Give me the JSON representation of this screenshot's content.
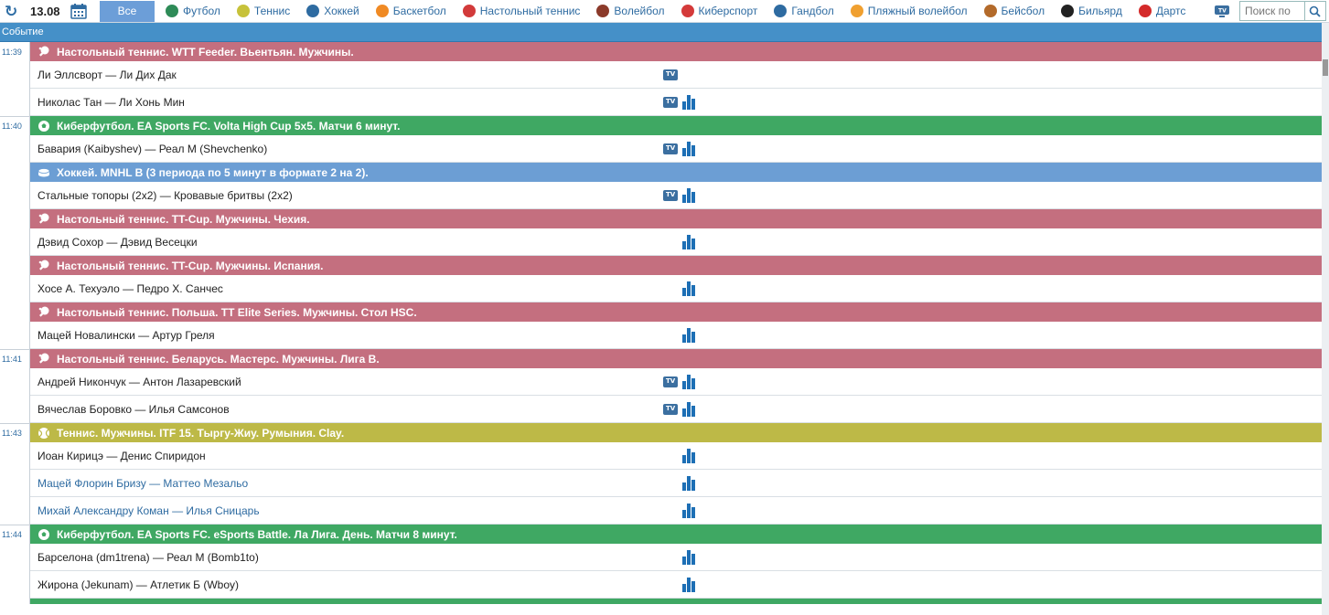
{
  "topbar": {
    "date": "13.08",
    "all_label": "Все",
    "sports": [
      {
        "label": "Футбол",
        "icon": "football-icon",
        "color": "#2e8b57"
      },
      {
        "label": "Теннис",
        "icon": "tennis-icon",
        "color": "#c7c23a"
      },
      {
        "label": "Хоккей",
        "icon": "hockey-icon",
        "color": "#2e6ba1"
      },
      {
        "label": "Баскетбол",
        "icon": "basketball-icon",
        "color": "#f08a24"
      },
      {
        "label": "Настольный теннис",
        "icon": "table-tennis-icon",
        "color": "#d23a3a"
      },
      {
        "label": "Волейбол",
        "icon": "volleyball-icon",
        "color": "#8b3a2a"
      },
      {
        "label": "Киберспорт",
        "icon": "gamepad-icon",
        "color": "#d43a3a"
      },
      {
        "label": "Гандбол",
        "icon": "handball-icon",
        "color": "#2e6ba1"
      },
      {
        "label": "Пляжный волейбол",
        "icon": "beach-volleyball-icon",
        "color": "#f0a030"
      },
      {
        "label": "Бейсбол",
        "icon": "baseball-icon",
        "color": "#b36a2a"
      },
      {
        "label": "Бильярд",
        "icon": "billiards-icon",
        "color": "#222222"
      },
      {
        "label": "Дартс",
        "icon": "darts-icon",
        "color": "#d42a2a"
      }
    ],
    "search_placeholder": "Поиск по"
  },
  "header": {
    "column_event": "Событие"
  },
  "times": [
    "11:39",
    "11:40",
    "11:41",
    "11:43",
    "11:44"
  ],
  "leagues": [
    {
      "title": "Настольный теннис. WTT Feeder. Вьентьян. Мужчины.",
      "type": "table-tennis",
      "matches": [
        {
          "name": "Ли Эллсворт — Ли Дих Дак",
          "tv": true,
          "stats": false
        },
        {
          "name": "Николас Тан — Ли Хонь Мин",
          "tv": true,
          "stats": true
        }
      ]
    },
    {
      "title": "Киберфутбол. EA Sports FC. Volta High Cup 5x5. Матчи 6 минут.",
      "type": "cyberfootball",
      "matches": [
        {
          "name": "Бавария (Kaibyshev) — Реал М (Shevchenko)",
          "tv": true,
          "stats": true
        }
      ]
    },
    {
      "title": "Хоккей. MNHL B (3 периода по 5 минут в формате 2 на 2).",
      "type": "hockey",
      "matches": [
        {
          "name": "Стальные топоры (2x2) — Кровавые бритвы (2x2)",
          "tv": true,
          "stats": true
        }
      ]
    },
    {
      "title": "Настольный теннис. TT-Cup. Мужчины. Чехия.",
      "type": "table-tennis",
      "matches": [
        {
          "name": "Дэвид Сохор — Дэвид Весецки",
          "tv": false,
          "stats": true
        }
      ]
    },
    {
      "title": "Настольный теннис. TT-Cup. Мужчины. Испания.",
      "type": "table-tennis",
      "matches": [
        {
          "name": "Хосе А. Техуэло — Педро Х. Санчес",
          "tv": false,
          "stats": true
        }
      ]
    },
    {
      "title": "Настольный теннис. Польша. TT Elite Series. Мужчины. Стол HSC.",
      "type": "table-tennis",
      "matches": [
        {
          "name": "Мацей Новалински — Артур Греля",
          "tv": false,
          "stats": true
        }
      ]
    },
    {
      "title": "Настольный теннис. Беларусь. Мастерс. Мужчины. Лига B.",
      "type": "table-tennis",
      "matches": [
        {
          "name": "Андрей Никончук — Антон Лазаревский",
          "tv": true,
          "stats": true
        },
        {
          "name": "Вячеслав Боровко — Илья Самсонов",
          "tv": true,
          "stats": true
        }
      ]
    },
    {
      "title": "Теннис. Мужчины. ITF 15. Тыргу-Жиу. Румыния. Clay.",
      "type": "tennis",
      "matches": [
        {
          "name": "Иоан Кирицэ — Денис Спиридон",
          "tv": false,
          "stats": true
        },
        {
          "name": "Мацей Флорин Бризу — Маттео Мезальо",
          "tv": false,
          "stats": true,
          "link": true
        },
        {
          "name": "Михай Александру Коман — Илья Сницарь",
          "tv": false,
          "stats": true,
          "link": true
        }
      ]
    },
    {
      "title": "Киберфутбол. EA Sports FC. eSports Battle. Ла Лига. День. Матчи 8 минут.",
      "type": "cyberfootball",
      "matches": [
        {
          "name": "Барселона (dm1trena) — Реал М (Bomb1to)",
          "tv": false,
          "stats": true
        },
        {
          "name": "Жирона (Jekunam) — Атлетик Б (Wboy)",
          "tv": false,
          "stats": true
        }
      ]
    }
  ]
}
